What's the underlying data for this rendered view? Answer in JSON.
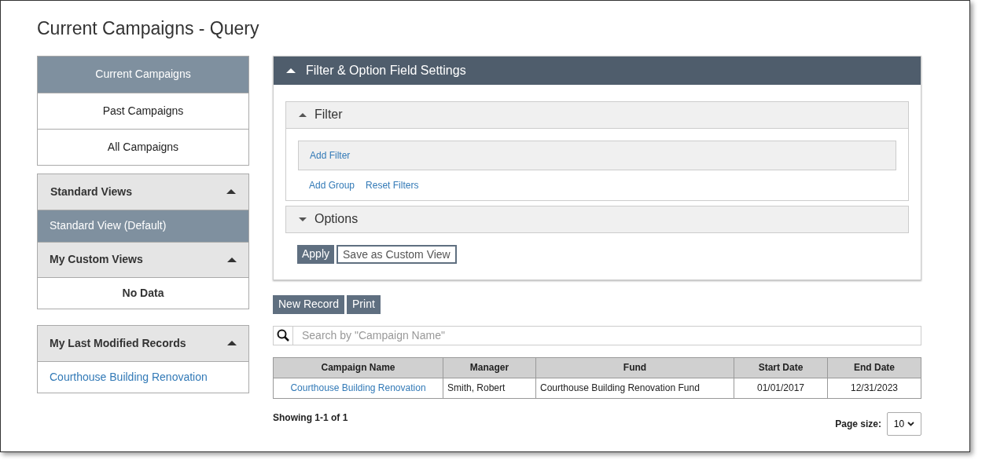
{
  "title": "Current Campaigns - Query",
  "campaign_tabs": [
    {
      "label": "Current Campaigns",
      "selected": true
    },
    {
      "label": "Past Campaigns",
      "selected": false
    },
    {
      "label": "All Campaigns",
      "selected": false
    }
  ],
  "standard_views": {
    "title": "Standard Views",
    "expanded": true,
    "items": [
      {
        "label": "Standard View (Default)",
        "selected": true
      }
    ]
  },
  "custom_views": {
    "title": "My Custom Views",
    "expanded": true,
    "empty_text": "No Data"
  },
  "last_modified": {
    "title": "My Last Modified Records",
    "expanded": true,
    "items": [
      "Courthouse Building Renovation"
    ]
  },
  "filter_settings": {
    "title": "Filter & Option Field Settings",
    "expanded": true,
    "filter": {
      "title": "Filter",
      "expanded": true,
      "add_filter": "Add Filter",
      "links": [
        "Add Group",
        "Reset Filters"
      ]
    },
    "options": {
      "title": "Options",
      "expanded": false
    },
    "buttons": [
      {
        "label": "Apply",
        "kind": "primary"
      },
      {
        "label": "Save as Custom View",
        "kind": "outline"
      }
    ]
  },
  "toolbar": [
    "New Record",
    "Print"
  ],
  "search": {
    "placeholder": "Search by \"Campaign Name\""
  },
  "table": {
    "columns": [
      "Campaign Name",
      "Manager",
      "Fund",
      "Start Date",
      "End Date"
    ],
    "rows": [
      {
        "cells": [
          {
            "text": "Courthouse Building Renovation",
            "kind": "link"
          },
          {
            "text": "Smith, Robert",
            "kind": "text"
          },
          {
            "text": "Courthouse Building Renovation Fund",
            "kind": "text"
          },
          {
            "text": "01/01/2017",
            "kind": "text"
          },
          {
            "text": "12/31/2023",
            "kind": "text"
          }
        ]
      }
    ]
  },
  "showing": "Showing 1-1 of 1",
  "page_size": {
    "label": "Page size:",
    "value": "10"
  }
}
